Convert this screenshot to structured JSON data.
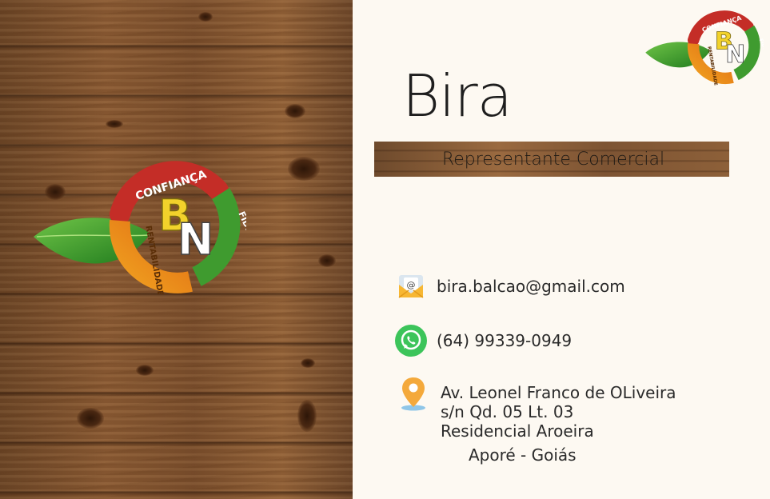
{
  "card": {
    "name": "Bira",
    "role": "Representante Comercial",
    "email": "bira.balcao@gmail.com",
    "phone": "(64) 99339-0949",
    "address_line1": "Av. Leonel Franco de OLiveira",
    "address_line2": "s/n Qd. 05 Lt. 03",
    "address_line3": "Residencial Aroeira",
    "city": "Aporé - Goiás"
  },
  "logo": {
    "initials_b": "B",
    "initials_n": "N",
    "word_top": "CONFIANÇA",
    "word_right": "FIDELIDADE",
    "word_left": "RENTABILIDADE"
  },
  "icons": [
    "email-icon",
    "whatsapp-icon",
    "location-pin-icon"
  ],
  "colors": {
    "background": "#fdf9f2",
    "text": "#2a2a2a",
    "whatsapp": "#3cc45a",
    "pin": "#f4a93b",
    "logo_red": "#c8302a",
    "logo_green": "#3f9b2f",
    "logo_orange": "#f08a1d",
    "logo_yellow": "#f2d22b"
  }
}
